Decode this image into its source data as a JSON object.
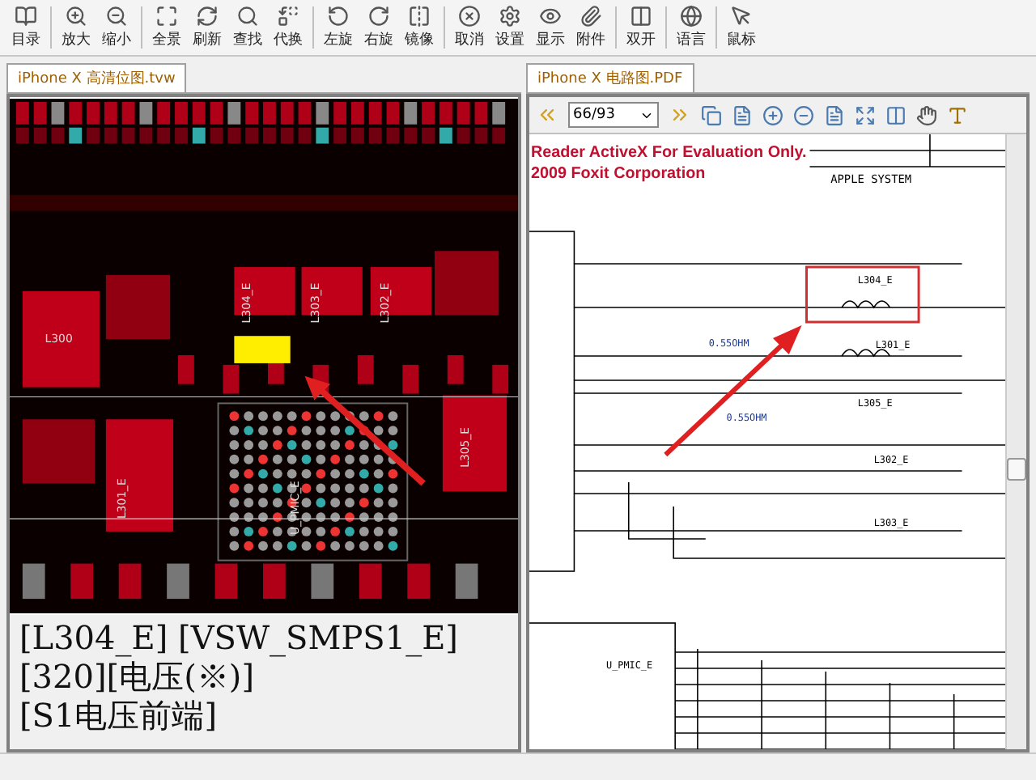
{
  "toolbar": {
    "buttons": [
      {
        "label": "目录"
      },
      {
        "label": "放大"
      },
      {
        "label": "缩小"
      },
      {
        "label": "全景"
      },
      {
        "label": "刷新"
      },
      {
        "label": "查找"
      },
      {
        "label": "代换"
      },
      {
        "label": "左旋"
      },
      {
        "label": "右旋"
      },
      {
        "label": "镜像"
      },
      {
        "label": "取消"
      },
      {
        "label": "设置"
      },
      {
        "label": "显示"
      },
      {
        "label": "附件"
      },
      {
        "label": "双开"
      },
      {
        "label": "语言"
      },
      {
        "label": "鼠标"
      }
    ]
  },
  "left_panel": {
    "tab": "iPhone X 高清位图.tvw",
    "board_labels": [
      "L300",
      "L304_E",
      "L303_E",
      "L302_E",
      "L301_E",
      "L305_E",
      "U_PMIC_E"
    ],
    "info_lines": [
      "[L304_E] [VSW_SMPS1_E]",
      "[320][电压(※)]",
      "[S1电压前端]"
    ]
  },
  "right_panel": {
    "tab": "iPhone X 电路图.PDF",
    "page_field": "66/93",
    "watermark": [
      "Reader ActiveX For Evaluation Only.",
      "2009 Foxit Corporation"
    ],
    "schematic_labels": [
      "APPLE SYSTEM",
      "L304_E",
      "L301_E",
      "0.55OHM",
      "L305_E",
      "0.55OHM",
      "L302_E",
      "L303_E",
      "U_PMIC_E"
    ]
  }
}
